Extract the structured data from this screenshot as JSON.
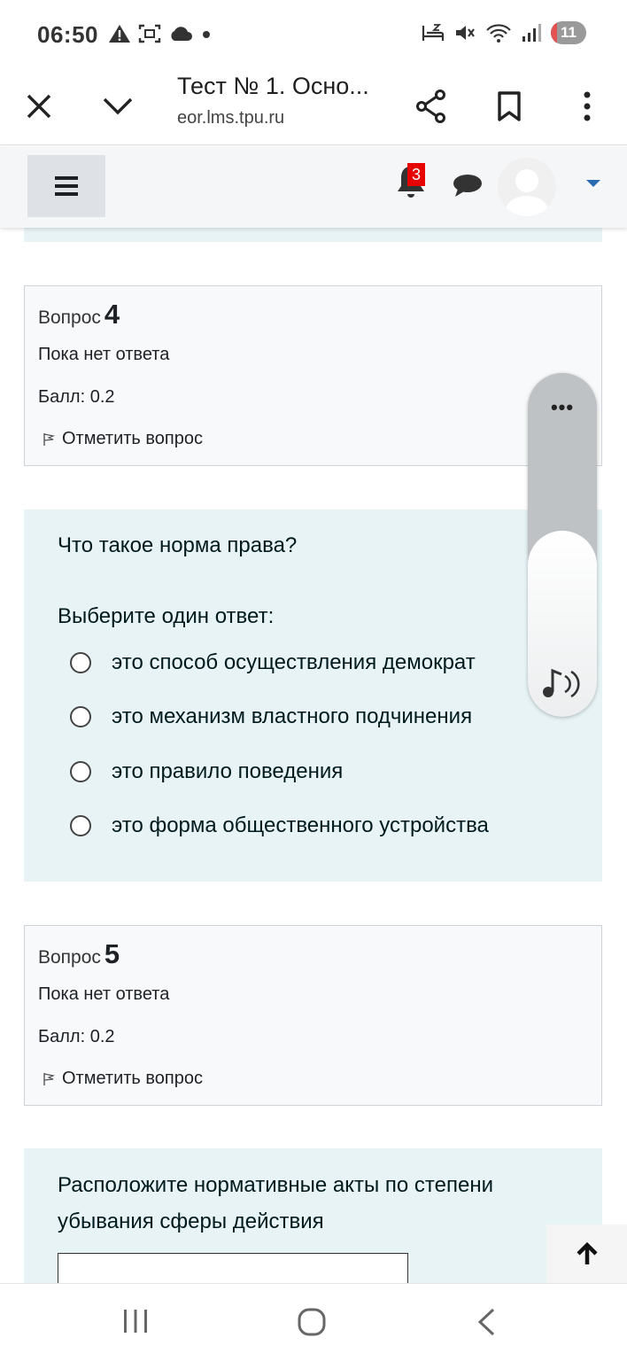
{
  "status_bar": {
    "time": "06:50",
    "battery_level": "11",
    "left_icons": [
      "warning-icon",
      "screenshot-icon",
      "cloud-icon",
      "dot-icon"
    ],
    "right_icons": [
      "sleep-icon",
      "mute-icon",
      "wifi-icon",
      "signal-icon"
    ]
  },
  "browser": {
    "title": "Тест № 1. Осно...",
    "url": "eor.lms.tpu.ru"
  },
  "navbar": {
    "notification_count": "3"
  },
  "questions": [
    {
      "label": "Вопрос",
      "number": "4",
      "state": "Пока нет ответа",
      "grade": "Балл: 0.2",
      "flag": "Отметить вопрос",
      "text": "Что такое норма права?",
      "prompt": "Выберите один ответ:",
      "options": [
        "это способ осуществления демократ",
        "это механизм властного подчинения",
        "это правило поведения",
        "это форма общественного устройства"
      ]
    },
    {
      "label": "Вопрос",
      "number": "5",
      "state": "Пока нет ответа",
      "grade": "Балл: 0.2",
      "flag": "Отметить вопрос",
      "text_lines": [
        "Расположите нормативные акты по степени",
        "убывания сферы действия"
      ]
    }
  ],
  "volume_panel": {
    "more": "•••",
    "level": 0.54
  },
  "colors": {
    "info_bg": "#f8f9fa",
    "formulation_bg": "#e7f3f5",
    "notification_red": "#e60000",
    "link_blue": "#2a6ab0"
  }
}
